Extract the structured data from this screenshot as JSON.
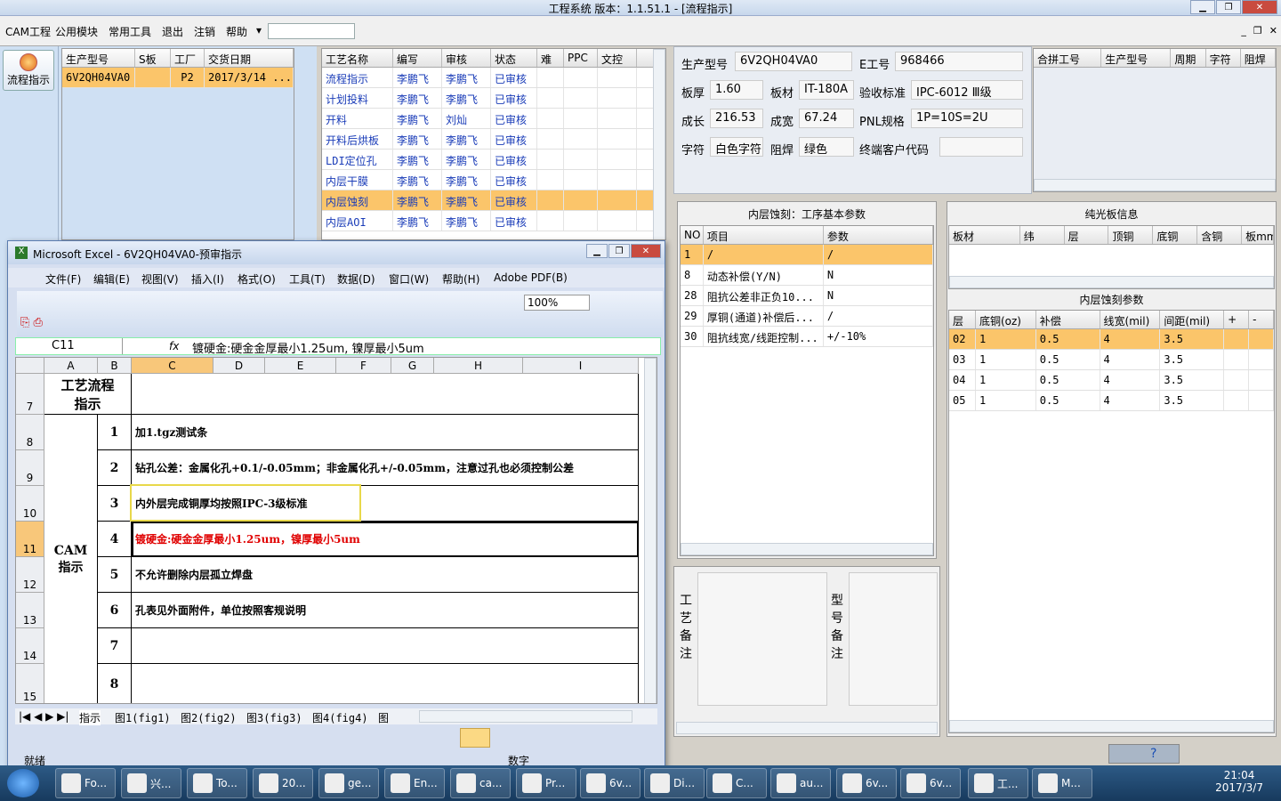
{
  "app": {
    "title": "工程系统  版本：1.1.51.1 - [流程指示]"
  },
  "menu": {
    "items": [
      "CAM工程",
      "公用模块",
      "常用工具",
      "退出",
      "注销",
      "帮助"
    ]
  },
  "nav": {
    "button_label": "流程指示"
  },
  "orders": {
    "headers": [
      "生产型号",
      "S板",
      "工厂",
      "交货日期"
    ],
    "rows": [
      [
        "6V2QH04VA0",
        "",
        "P2",
        "2017/3/14 ..."
      ]
    ]
  },
  "process": {
    "headers": [
      "工艺名称",
      "编写",
      "审核",
      "状态",
      "难",
      "PPC",
      "文控"
    ],
    "rows": [
      [
        "流程指示",
        "李鹏飞",
        "李鹏飞",
        "已审核"
      ],
      [
        "计划投料",
        "李鹏飞",
        "李鹏飞",
        "已审核"
      ],
      [
        "开料",
        "李鹏飞",
        "刘灿",
        "已审核"
      ],
      [
        "开料后烘板",
        "李鹏飞",
        "李鹏飞",
        "已审核"
      ],
      [
        "LDI定位孔",
        "李鹏飞",
        "李鹏飞",
        "已审核"
      ],
      [
        "内层干膜",
        "李鹏飞",
        "李鹏飞",
        "已审核"
      ],
      [
        "内层蚀刻",
        "李鹏飞",
        "李鹏飞",
        "已审核"
      ],
      [
        "内层AOI",
        "李鹏飞",
        "李鹏飞",
        "已审核"
      ]
    ],
    "selected_index": 6
  },
  "info": {
    "model_label": "生产型号",
    "model": "6V2QH04VA0",
    "e_label": "E工号",
    "e_no": "968466",
    "thick_label": "板厚",
    "thick": "1.60",
    "material_label": "板材",
    "material": "IT-180A",
    "std_label": "验收标准",
    "std": "IPC-6012 Ⅲ级",
    "len_label": "成长",
    "len": "216.53",
    "width_label": "成宽",
    "width": "67.24",
    "pnl_label": "PNL规格",
    "pnl": "1P=10S=2U",
    "char_label": "字符",
    "char": "白色字符",
    "mask_label": "阻焊",
    "mask": "绿色",
    "cust_label": "终端客户代码",
    "cust": ""
  },
  "merge": {
    "headers": [
      "合拼工号",
      "生产型号",
      "周期",
      "字符",
      "阻焊"
    ]
  },
  "etch_params": {
    "title": "内层蚀刻：工序基本参数",
    "headers": [
      "NO",
      "项目",
      "参数"
    ],
    "rows": [
      [
        "1",
        "/",
        "/"
      ],
      [
        "8",
        "动态补偿(Y/N)",
        "N"
      ],
      [
        "28",
        "阻抗公差非正负10...",
        "N"
      ],
      [
        "29",
        "厚铜(通道)补偿后...",
        "/"
      ],
      [
        "30",
        "阻抗线宽/线距控制...",
        "+/-10%"
      ]
    ]
  },
  "plain_board": {
    "title": "纯光板信息",
    "headers": [
      "板材",
      "纬",
      "层",
      "顶铜",
      "底铜",
      "含铜",
      "板mm"
    ]
  },
  "inner_etch": {
    "title": "内层蚀刻参数",
    "headers": [
      "层",
      "底铜(oz)",
      "补偿",
      "线宽(mil)",
      "间距(mil)",
      "+",
      "-"
    ],
    "rows": [
      [
        "02",
        "1",
        "0.5",
        "4",
        "3.5"
      ],
      [
        "03",
        "1",
        "0.5",
        "4",
        "3.5"
      ],
      [
        "04",
        "1",
        "0.5",
        "4",
        "3.5"
      ],
      [
        "05",
        "1",
        "0.5",
        "4",
        "3.5"
      ]
    ]
  },
  "remarks": {
    "craft": "工艺备注",
    "model": "型号备注"
  },
  "excel": {
    "title": "Microsoft Excel - 6V2QH04VA0-预审指示",
    "menu": [
      "文件(F)",
      "编辑(E)",
      "视图(V)",
      "插入(I)",
      "格式(O)",
      "工具(T)",
      "数据(D)",
      "窗口(W)",
      "帮助(H)",
      "Adobe PDF(B)"
    ],
    "zoom": "100%",
    "namebox": "C11",
    "fx": "fx",
    "formula": "镀硬金:硬金金厚最小1.25um, 镍厚最小5um",
    "cols": [
      "A",
      "B",
      "C",
      "D",
      "E",
      "F",
      "G",
      "H",
      "I"
    ],
    "rows": [
      "7",
      "8",
      "9",
      "10",
      "11",
      "12",
      "13",
      "14",
      "15"
    ],
    "section1": "工艺流程指示",
    "section2": "CAM指示",
    "items": [
      {
        "no": "1",
        "text": "加1.tgz测试条"
      },
      {
        "no": "2",
        "text": "钻孔公差：金属化孔+0.1/-0.05mm；非金属化孔+/-0.05mm，注意过孔也必须控制公差"
      },
      {
        "no": "3",
        "text": "内外层完成铜厚均按照IPC-3级标准"
      },
      {
        "no": "4",
        "text": "镀硬金:硬金金厚最小1.25um，镍厚最小5um"
      },
      {
        "no": "5",
        "text": "不允许删除内层孤立焊盘"
      },
      {
        "no": "6",
        "text": "孔表见外面附件，单位按照客规说明"
      },
      {
        "no": "7",
        "text": ""
      },
      {
        "no": "8",
        "text": ""
      }
    ],
    "tabs": [
      "指示",
      "图1(fig1)",
      "图2(fig2)",
      "图3(fig3)",
      "图4(fig4)",
      "图"
    ],
    "status_ready": "就绪",
    "status_num": "数字"
  },
  "taskbar": {
    "items": [
      "Fo...",
      "兴...",
      "To...",
      "20...",
      "ge...",
      "En...",
      "ca...",
      "Pr...",
      "6v...",
      "Di...",
      "C...",
      "au...",
      "6v...",
      "6v...",
      "工...",
      "M..."
    ],
    "time": "21:04",
    "date": "2017/3/7"
  },
  "colors": {
    "selection": "#fbc56a",
    "link": "#1a3cb8",
    "red_text": "#e00000",
    "highlight_box": "#e8d84a"
  }
}
